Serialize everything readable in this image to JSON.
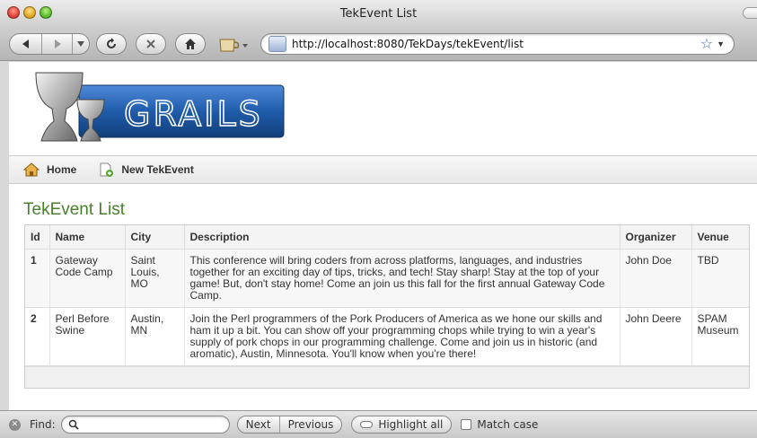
{
  "window": {
    "title": "TekEvent List"
  },
  "toolbar": {
    "url": "http://localhost:8080/TekDays/tekEvent/list"
  },
  "nav": {
    "home": "Home",
    "new_event": "New TekEvent"
  },
  "page": {
    "heading": "TekEvent List"
  },
  "table": {
    "headers": [
      "Id",
      "Name",
      "City",
      "Description",
      "Organizer",
      "Venue"
    ],
    "rows": [
      {
        "id": "1",
        "name": "Gateway Code Camp",
        "city": "Saint Louis, MO",
        "description": "This conference will bring coders from across platforms, languages, and industries together for an exciting day of tips, tricks, and tech! Stay sharp! Stay at the top of your game! But, don't stay home! Come an join us this fall for the first annual Gateway Code Camp.",
        "organizer": "John Doe",
        "venue": "TBD"
      },
      {
        "id": "2",
        "name": "Perl Before Swine",
        "city": "Austin, MN",
        "description": "Join the Perl programmers of the Pork Producers of America as we hone our skills and ham it up a bit. You can show off your programming chops while trying to win a year's supply of pork chops in our programming challenge. Come and join us in historic (and aromatic), Austin, Minnesota. You'll know when you're there!",
        "organizer": "John Deere",
        "venue": "SPAM Museum"
      }
    ]
  },
  "findbar": {
    "label": "Find:",
    "value": "",
    "next": "Next",
    "previous": "Previous",
    "highlight_all": "Highlight all",
    "match_case": "Match case"
  },
  "logo": {
    "text": "GRAILS"
  },
  "colors": {
    "heading": "#48802c",
    "logo_blue": "#1c4f8f"
  }
}
